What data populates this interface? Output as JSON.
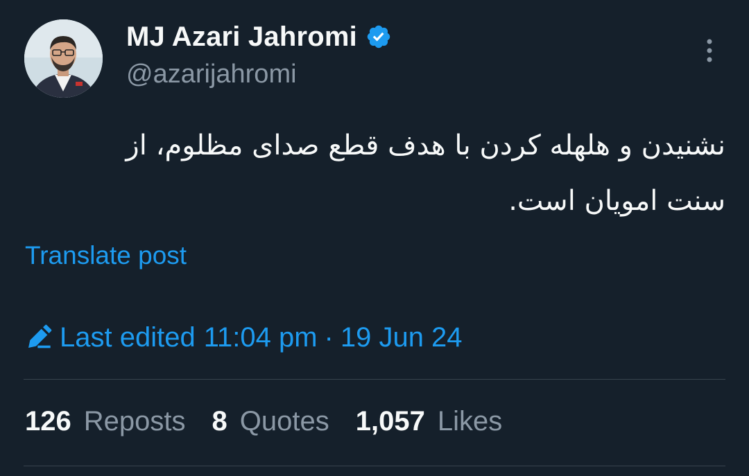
{
  "author": {
    "display_name": "MJ Azari Jahromi",
    "handle": "@azarijahromi",
    "verified_icon": "verified-badge-icon",
    "avatar": "profile-photo"
  },
  "tweet": {
    "text": "نشنیدن و هلهله کردن با هدف قطع صدای مظلوم، از\nسنت امویان است.",
    "translate_label": "Translate post",
    "edited_label": "Last edited",
    "time": "11:04 pm",
    "separator": "·",
    "date": "19 Jun 24"
  },
  "stats": {
    "reposts_count": "126",
    "reposts_label": "Reposts",
    "quotes_count": "8",
    "quotes_label": "Quotes",
    "likes_count": "1,057",
    "likes_label": "Likes"
  },
  "colors": {
    "background": "#15202b",
    "accent": "#1d9bf0",
    "primary_text": "#f7f9f9",
    "secondary_text": "#8b98a5",
    "divider": "#38444d"
  }
}
